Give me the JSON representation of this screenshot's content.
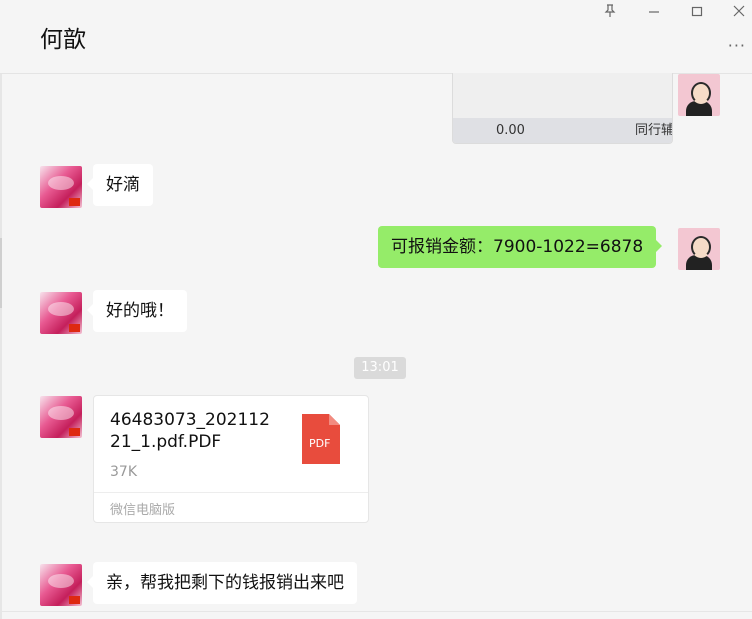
{
  "header": {
    "title": "何歆",
    "pin_icon": "pin-icon",
    "minimize_icon": "minimize-icon",
    "maximize_icon": "maximize-icon",
    "close_icon": "close-icon",
    "more_icon": "more-icon"
  },
  "messages": {
    "card_top": {
      "amount": "0.00",
      "tag": "同行辅"
    },
    "m1": {
      "text": "好滴"
    },
    "m2": {
      "text": "可报销金额：7900-1022=6878"
    },
    "m3": {
      "text": "好的哦！"
    },
    "time": "13:01",
    "file": {
      "name": "46483073_20211221_1.pdf.PDF",
      "size": "37K",
      "source": "微信电脑版",
      "icon_label": "PDF",
      "icon_color": "#e84c3d"
    },
    "m4": {
      "text": "亲，帮我把剩下的钱报销出来吧"
    }
  }
}
